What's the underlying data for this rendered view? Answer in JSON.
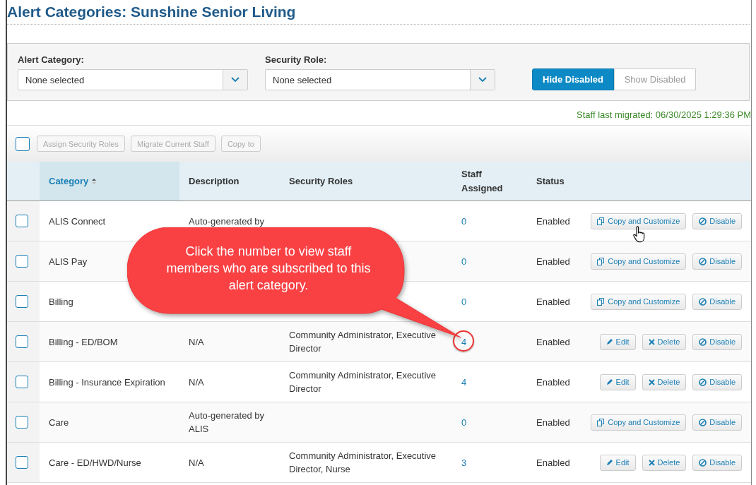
{
  "title": "Alert Categories: Sunshine Senior Living",
  "filters": [
    {
      "label": "Alert Category:",
      "value": "None selected"
    },
    {
      "label": "Security Role:",
      "value": "None selected"
    }
  ],
  "toggle": [
    {
      "label": "Hide Disabled",
      "selected": true
    },
    {
      "label": "Show Disabled",
      "selected": false
    }
  ],
  "migrated": "Staff last migrated: 06/30/2025 1:29:36 PM",
  "toolbar": {
    "select_all": {
      "checked": false
    },
    "buttons": [
      "Assign Security Roles",
      "Migrate Current Staff",
      "Copy to"
    ]
  },
  "columns": [
    {
      "label": "Category",
      "sorted": true
    },
    {
      "label": "Description",
      "sorted": false
    },
    {
      "label": "Security Roles",
      "sorted": false
    },
    {
      "label": "Staff Assigned",
      "sorted": false
    },
    {
      "label": "Status",
      "sorted": false
    }
  ],
  "rows": [
    {
      "checked": false,
      "category": "ALIS Connect",
      "description": "Auto-generated by",
      "roles": "",
      "staff": "0",
      "status": "Enabled",
      "kind": "system",
      "circled": false,
      "actions": [
        "Copy and Customize",
        "Disable"
      ]
    },
    {
      "checked": false,
      "category": "ALIS Pay",
      "description": "",
      "roles": "",
      "staff": "0",
      "status": "Enabled",
      "kind": "system",
      "circled": false,
      "actions": [
        "Copy and Customize",
        "Disable"
      ]
    },
    {
      "checked": false,
      "category": "Billing",
      "description": "",
      "roles": "",
      "staff": "0",
      "status": "Enabled",
      "kind": "system",
      "circled": false,
      "actions": [
        "Copy and Customize",
        "Disable"
      ]
    },
    {
      "checked": false,
      "category": "Billing - ED/BOM",
      "description": "N/A",
      "roles": "Community Administrator, Executive Director",
      "staff": "4",
      "status": "Enabled",
      "kind": "custom",
      "circled": true,
      "actions": [
        "Edit",
        "Delete",
        "Disable"
      ]
    },
    {
      "checked": false,
      "category": "Billing - Insurance Expiration",
      "description": "N/A",
      "roles": "Community Administrator, Executive Director",
      "staff": "4",
      "status": "Enabled",
      "kind": "custom",
      "circled": false,
      "actions": [
        "Edit",
        "Delete",
        "Disable"
      ]
    },
    {
      "checked": false,
      "category": "Care",
      "description": "Auto-generated by ALIS",
      "roles": "",
      "staff": "0",
      "status": "Enabled",
      "kind": "system",
      "circled": false,
      "actions": [
        "Copy and Customize",
        "Disable"
      ]
    },
    {
      "checked": false,
      "category": "Care - ED/HWD/Nurse",
      "description": "N/A",
      "roles": "Community Administrator, Executive Director, Nurse",
      "staff": "3",
      "status": "Enabled",
      "kind": "custom",
      "circled": false,
      "actions": [
        "Edit",
        "Delete",
        "Disable"
      ]
    }
  ],
  "callout": "Click the number to view staff members who are subscribed to this alert category."
}
